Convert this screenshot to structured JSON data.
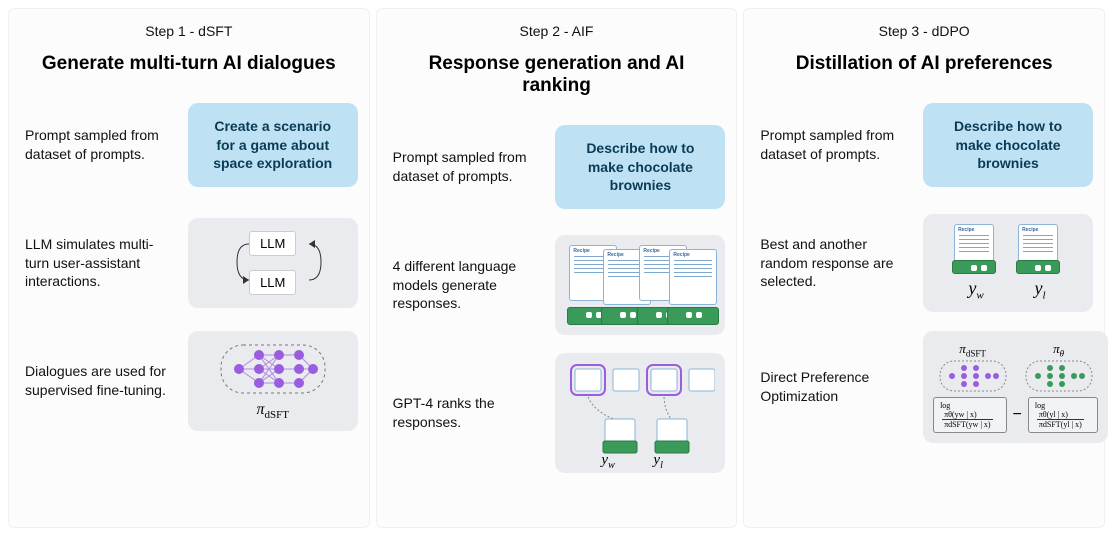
{
  "columns": [
    {
      "step": "Step 1 - dSFT",
      "title": "Generate multi-turn AI dialogues",
      "rows": [
        {
          "desc": "Prompt sampled from dataset of prompts.",
          "prompt": "Create a scenario for a game about space exploration"
        },
        {
          "desc": "LLM simulates multi-turn user-assistant interactions.",
          "llm": "LLM"
        },
        {
          "desc": "Dialogues are used for supervised fine-tuning.",
          "pi": "π",
          "pi_sub": "dSFT"
        }
      ]
    },
    {
      "step": "Step 2 - AIF",
      "title": "Response generation and AI ranking",
      "rows": [
        {
          "desc": "Prompt sampled from dataset of prompts.",
          "prompt": "Describe how to make chocolate brownies"
        },
        {
          "desc": "4 different language models generate responses."
        },
        {
          "desc": "GPT-4 ranks the responses.",
          "yw": "y",
          "yw_sub": "w",
          "yl": "y",
          "yl_sub": "l"
        }
      ]
    },
    {
      "step": "Step 3 - dDPO",
      "title": "Distillation of AI preferences",
      "rows": [
        {
          "desc": "Prompt sampled from dataset of prompts.",
          "prompt": "Describe how to make chocolate brownies"
        },
        {
          "desc": "Best and another random response are selected.",
          "yw": "y",
          "yw_sub": "w",
          "yl": "y",
          "yl_sub": "l"
        },
        {
          "desc": "Direct Preference Optimization",
          "pi_dsft": "π",
          "pi_dsft_sub": "dSFT",
          "pi_theta": "π",
          "pi_theta_sub": "θ",
          "eq1a": "log",
          "eq1b": "πθ(yw | x)",
          "eq1c": "πdSFT(yw | x)",
          "eq2a": "log",
          "eq2b": "πθ(yl | x)",
          "eq2c": "πdSFT(yl | x)"
        }
      ]
    }
  ]
}
